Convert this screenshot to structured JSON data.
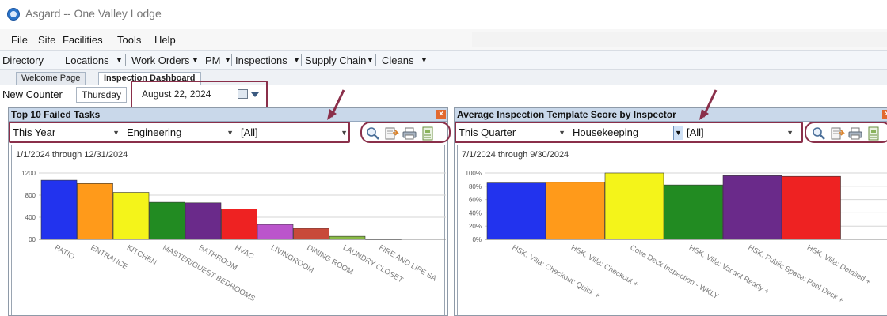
{
  "app": {
    "title": "Asgard -- One Valley Lodge"
  },
  "menu": [
    "File",
    "Site",
    "Facilities",
    "Tools",
    "Help"
  ],
  "nav": [
    "Directory",
    "Locations",
    "Work Orders",
    "PM",
    "Inspections",
    "Supply Chain",
    "Cleans"
  ],
  "tabs": [
    {
      "label": "Welcome Page",
      "active": false
    },
    {
      "label": "Inspection Dashboard",
      "active": true
    }
  ],
  "toolbar": {
    "new_counter_label": "New Counter",
    "weekday": "Thursday",
    "date": "August   22, 2024"
  },
  "left_panel": {
    "title": "Top 10 Failed Tasks",
    "filters": {
      "period": "This Year",
      "department": "Engineering",
      "scope": "[All]"
    },
    "range": "1/1/2024 through 12/31/2024"
  },
  "right_panel": {
    "title": "Average Inspection Template Score by Inspector",
    "filters": {
      "period": "This Quarter",
      "department": "Housekeeping",
      "scope": "[All]"
    },
    "range": "7/1/2024 through 9/30/2024"
  },
  "icons": [
    "search-icon",
    "export-icon",
    "print-icon",
    "save-icon"
  ],
  "colors": {
    "highlight": "#8a2f4a",
    "panel_header": "#c9d8ea",
    "close": "#e2692f"
  },
  "chart_data": [
    {
      "type": "bar",
      "title": "Top 10 Failed Tasks",
      "categories": [
        "PATIO",
        "ENTRANCE",
        "KITCHEN",
        "MASTER/GUEST BEDROOMS",
        "BATHROOM",
        "HVAC",
        "LIVINGROOM",
        "DINING ROOM",
        "LAUNDRY CLOSET",
        "FIRE AND LIFE SA"
      ],
      "values": [
        1070,
        1010,
        850,
        670,
        660,
        550,
        270,
        200,
        55,
        10
      ],
      "colors": [
        "#2233ee",
        "#ff9a1a",
        "#f4f41a",
        "#228b22",
        "#6a2a8a",
        "#ee2222",
        "#bb55cc",
        "#c84a3a",
        "#88bb44",
        "#333333"
      ],
      "yticks": [
        "1200",
        "800",
        "400",
        "00"
      ],
      "ylim": [
        0,
        1200
      ],
      "grid": true
    },
    {
      "type": "bar",
      "title": "Average Inspection Template Score by Inspector",
      "categories": [
        "HSK: Villa: Checkout: Quick +",
        "HSK: Villa: Checkout +",
        "Cove Deck Inspection - WKLY",
        "HSK: Villa: Vacant Ready +",
        "HSK: Public Space: Pool Deck +",
        "HSK: Villa: Detailed +"
      ],
      "values": [
        85,
        86,
        100,
        82,
        96,
        95
      ],
      "colors": [
        "#2233ee",
        "#ff9a1a",
        "#f4f41a",
        "#228b22",
        "#6a2a8a",
        "#ee2222"
      ],
      "yticks": [
        "100%",
        "80%",
        "60%",
        "40%",
        "20%",
        "0%"
      ],
      "ylim": [
        0,
        100
      ],
      "grid": true
    }
  ]
}
